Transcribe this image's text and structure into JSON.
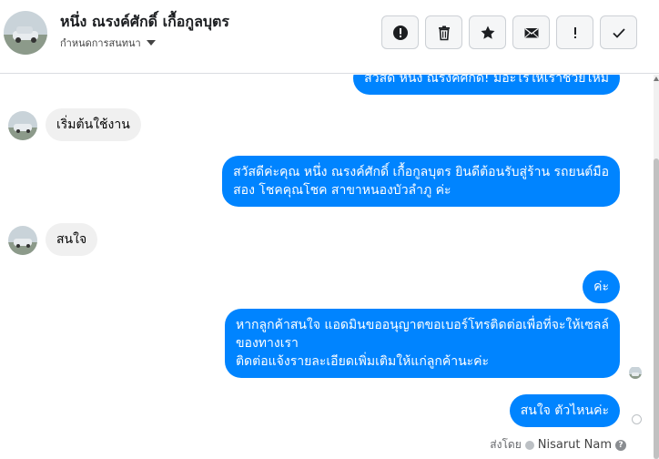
{
  "header": {
    "contact_name": "หนึ่ง ณรงค์ศักดิ์ เกื้อกูลบุตร",
    "subtitle": "กำหนดการสนทนา",
    "toolbar": [
      {
        "name": "report-button",
        "icon": "exclamation-circle-icon"
      },
      {
        "name": "delete-button",
        "icon": "trash-icon"
      },
      {
        "name": "star-button",
        "icon": "star-icon"
      },
      {
        "name": "mail-button",
        "icon": "envelope-icon"
      },
      {
        "name": "mark-important-button",
        "icon": "exclamation-icon"
      },
      {
        "name": "mark-done-button",
        "icon": "check-icon"
      }
    ]
  },
  "messages": [
    {
      "dir": "out",
      "text": "สวัสดี หนึ่ง ณรงค์ศักดิ์! มีอะไรให้เราช่วยไหม"
    },
    {
      "dir": "in",
      "text": "เริ่มต้นใช้งาน"
    },
    {
      "dir": "out",
      "lines": [
        "สวัสดีค่ะคุณ หนึ่ง ณรงค์ศักดิ์ เกื้อกูลบุตร ยินดีต้อนรับสู่ร้าน รถยนต์มือ",
        "สอง โชคคุณโชค สาขาหนองบัวลำภู ค่ะ"
      ]
    },
    {
      "dir": "in",
      "text": "สนใจ"
    },
    {
      "dir": "out",
      "text": "ค่ะ"
    },
    {
      "dir": "out",
      "lines": [
        "หากลูกค้าสนใจ แอดมินขออนุญาตขอเบอร์โทรติดต่อเพื่อที่จะให้เซลล์",
        "ของทางเรา",
        "ติดต่อแจ้งรายละเอียดเพิ่มเติมให้แก่ลูกค้านะค่ะ"
      ]
    },
    {
      "dir": "out",
      "text": "สนใจ ตัวไหนค่ะ"
    }
  ],
  "footer": {
    "sent_by_label": "ส่งโดย",
    "sender_name": "Nisarut Nam"
  },
  "colors": {
    "outgoing_bubble": "#0084ff",
    "incoming_bubble": "#f0f0f0"
  }
}
